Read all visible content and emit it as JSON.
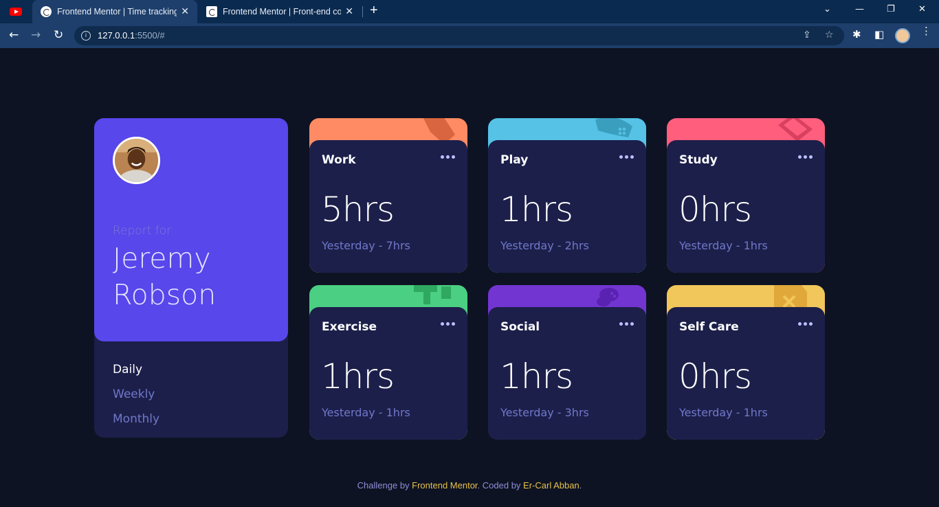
{
  "browser": {
    "tabs": [
      {
        "title": "Frontend Mentor | Time tracking"
      },
      {
        "title": "Frontend Mentor | Front-end coding challenges"
      }
    ],
    "url_host": "127.0.0.1",
    "url_rest": ":5500/#"
  },
  "profile": {
    "report_for": "Report for",
    "name": "Jeremy Robson",
    "periods": [
      "Daily",
      "Weekly",
      "Monthly"
    ],
    "active_period": "Daily"
  },
  "cards": [
    {
      "title": "Work",
      "current": "5hrs",
      "previous": "Yesterday - 7hrs",
      "color": "#ff8b64",
      "icon": "briefcase-icon"
    },
    {
      "title": "Play",
      "current": "1hrs",
      "previous": "Yesterday - 2hrs",
      "color": "#55c2e6",
      "icon": "gamepad-icon"
    },
    {
      "title": "Study",
      "current": "0hrs",
      "previous": "Yesterday - 1hrs",
      "color": "#ff5e7d",
      "icon": "book-icon"
    },
    {
      "title": "Exercise",
      "current": "1hrs",
      "previous": "Yesterday - 1hrs",
      "color": "#4bcf82",
      "icon": "runner-icon"
    },
    {
      "title": "Social",
      "current": "1hrs",
      "previous": "Yesterday - 3hrs",
      "color": "#7335d2",
      "icon": "people-icon"
    },
    {
      "title": "Self Care",
      "current": "0hrs",
      "previous": "Yesterday - 1hrs",
      "color": "#f1c75b",
      "icon": "heart-icon"
    }
  ],
  "attribution": {
    "prefix": "Challenge by ",
    "link1": "Frontend Mentor",
    "middle": ". Coded by ",
    "link2": "Er-Carl Abban",
    "suffix": "."
  }
}
